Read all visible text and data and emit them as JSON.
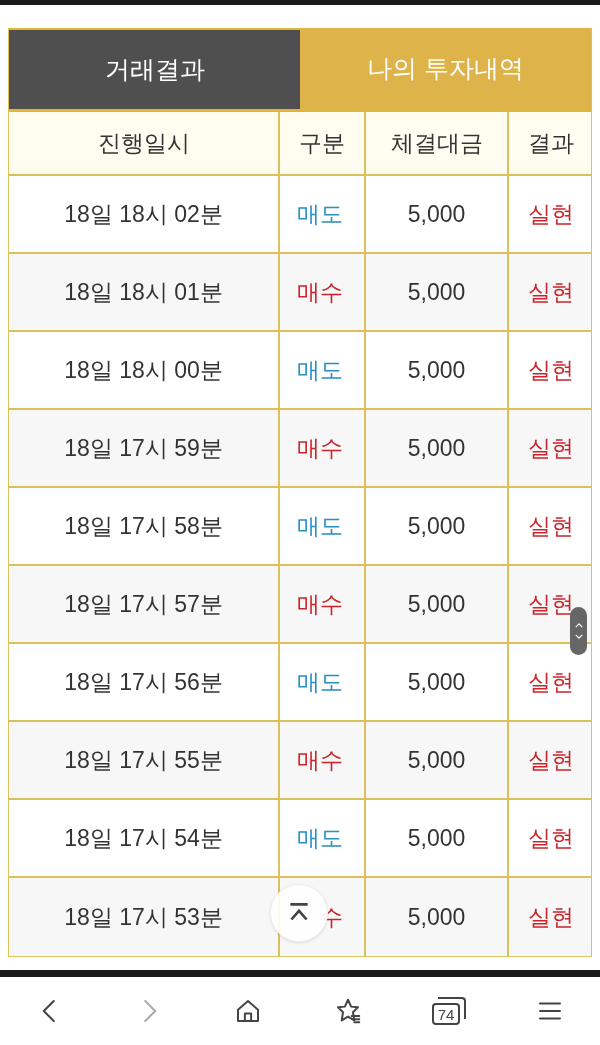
{
  "tabs": [
    {
      "label": "거래결과",
      "selected": true
    },
    {
      "label": "나의 투자내역",
      "selected": false
    }
  ],
  "table": {
    "columns": [
      "진행일시",
      "구분",
      "체결대금",
      "결과"
    ],
    "rows": [
      {
        "time": "18일 18시 02분",
        "kind": "sell",
        "side": "매도",
        "amount": "5,000",
        "result": "실현"
      },
      {
        "time": "18일 18시 01분",
        "kind": "buy",
        "side": "매수",
        "amount": "5,000",
        "result": "실현"
      },
      {
        "time": "18일 18시 00분",
        "kind": "sell",
        "side": "매도",
        "amount": "5,000",
        "result": "실현"
      },
      {
        "time": "18일 17시 59분",
        "kind": "buy",
        "side": "매수",
        "amount": "5,000",
        "result": "실현"
      },
      {
        "time": "18일 17시 58분",
        "kind": "sell",
        "side": "매도",
        "amount": "5,000",
        "result": "실현"
      },
      {
        "time": "18일 17시 57분",
        "kind": "buy",
        "side": "매수",
        "amount": "5,000",
        "result": "실현"
      },
      {
        "time": "18일 17시 56분",
        "kind": "sell",
        "side": "매도",
        "amount": "5,000",
        "result": "실현"
      },
      {
        "time": "18일 17시 55분",
        "kind": "buy",
        "side": "매수",
        "amount": "5,000",
        "result": "실현"
      },
      {
        "time": "18일 17시 54분",
        "kind": "sell",
        "side": "매도",
        "amount": "5,000",
        "result": "실현"
      },
      {
        "time": "18일 17시 53분",
        "kind": "buy",
        "side": "수",
        "amount": "5,000",
        "result": "실현"
      }
    ]
  },
  "browser_bar": {
    "tab_count": "74"
  }
}
